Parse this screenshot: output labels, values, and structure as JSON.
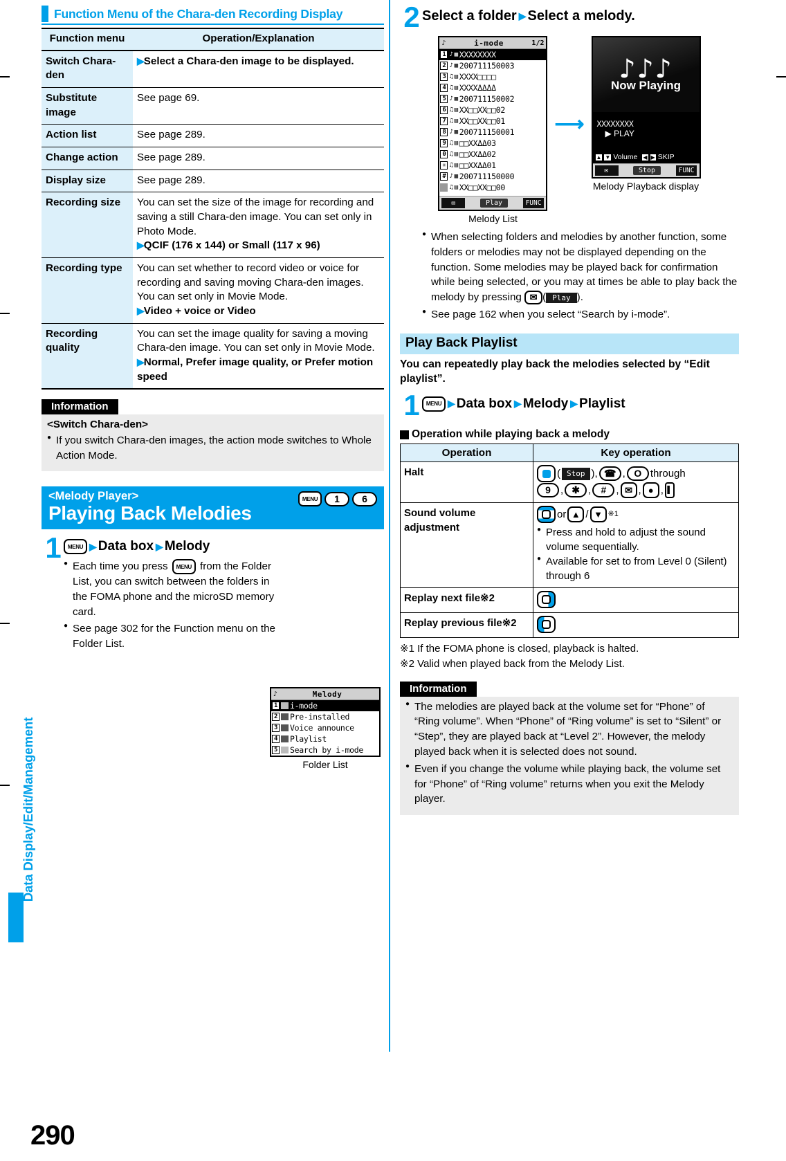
{
  "side_tab": {
    "label": "Data Display/Edit/Management"
  },
  "page_number": "290",
  "left": {
    "section_heading": "Function Menu of the Chara-den Recording Display",
    "table": {
      "headers": [
        "Function menu",
        "Operation/Explanation"
      ],
      "rows": [
        {
          "menu": "Switch Chara-den",
          "arrow": true,
          "bold_text": "Select a Chara-den image to be displayed.",
          "text": ""
        },
        {
          "menu": "Substitute image",
          "arrow": false,
          "text": "See page 69."
        },
        {
          "menu": "Action list",
          "arrow": false,
          "text": "See page 289."
        },
        {
          "menu": "Change action",
          "arrow": false,
          "text": "See page 289."
        },
        {
          "menu": "Display size",
          "arrow": false,
          "text": "See page 289."
        },
        {
          "menu": "Recording size",
          "arrow": true,
          "text": "You can set the size of the image for recording and saving a still Chara-den image. You can set only in Photo Mode.",
          "bold_text": "QCIF (176 x 144) or Small (117 x 96)"
        },
        {
          "menu": "Recording type",
          "arrow": true,
          "text": "You can set whether to record video or voice for recording and saving moving Chara-den images. You can set only in Movie Mode.",
          "bold_text": "Video + voice or Video"
        },
        {
          "menu": "Recording quality",
          "arrow": true,
          "text": "You can set the image quality for saving a moving Chara-den image. You can set only in Movie Mode.",
          "bold_text": "Normal, Prefer image quality, or Prefer motion speed"
        }
      ]
    },
    "information": {
      "tag": "Information",
      "subtitle": "<Switch Chara-den>",
      "bullets": [
        "If you switch Chara-den images, the action mode switches to Whole Action Mode."
      ]
    },
    "title_band": {
      "small": "<Melody Player>",
      "big": "Playing Back Melodies",
      "keys": [
        "MENU",
        "1",
        "6"
      ]
    },
    "step1": {
      "number": "1",
      "key": "MENU",
      "path": [
        "Data box",
        "Melody"
      ],
      "bullets": [
        "Each time you press MENU from the Folder List, you can switch between the folders in the FOMA phone and the microSD memory card.",
        "See page 302 for the Function menu on the Folder List."
      ]
    },
    "folder_list_screen": {
      "title": "Melody",
      "caption": "Folder List",
      "items": [
        {
          "idx": "1",
          "label": "i-mode",
          "selected": true
        },
        {
          "idx": "2",
          "label": "Pre-installed",
          "selected": false
        },
        {
          "idx": "3",
          "label": "Voice announce",
          "selected": false
        },
        {
          "idx": "4",
          "label": "Playlist",
          "selected": false
        },
        {
          "idx": "5",
          "label": "Search by i-mode",
          "selected": false
        }
      ]
    }
  },
  "right": {
    "step2": {
      "number": "2",
      "text_parts": [
        "Select a folder",
        "Select a melody."
      ]
    },
    "melody_list_screen": {
      "title": "i-mode",
      "page_indicator": "1/2",
      "caption": "Melody List",
      "items": [
        {
          "idx": "1",
          "label": "XXXXXXXX",
          "selected": true
        },
        {
          "idx": "2",
          "label": "200711150003",
          "selected": false
        },
        {
          "idx": "3",
          "label": "XXXX□□□□",
          "selected": false
        },
        {
          "idx": "4",
          "label": "XXXXΔΔΔΔ",
          "selected": false
        },
        {
          "idx": "5",
          "label": "200711150002",
          "selected": false
        },
        {
          "idx": "6",
          "label": "XX□□XX□□02",
          "selected": false
        },
        {
          "idx": "7",
          "label": "XX□□XX□□01",
          "selected": false
        },
        {
          "idx": "8",
          "label": "200711150001",
          "selected": false
        },
        {
          "idx": "9",
          "label": "□□XXΔΔ03",
          "selected": false
        },
        {
          "idx": "0",
          "label": "□□XXΔΔ02",
          "selected": false
        },
        {
          "idx": "✳",
          "label": "□□XXΔΔ01",
          "selected": false
        },
        {
          "idx": "#",
          "label": "200711150000",
          "selected": false
        },
        {
          "idx": "",
          "label": "XX□□XX□□00",
          "selected": false
        }
      ],
      "soft_keys": {
        "left": "mail-icon",
        "center": "Play",
        "right": "FUNC"
      }
    },
    "playback_screen": {
      "notes": "♪♪♪",
      "now_playing": "Now Playing",
      "file_name": "XXXXXXXX",
      "status": "PLAY",
      "volume_label": "Volume",
      "skip_label": "SKIP",
      "soft_keys": {
        "left": "mail-icon",
        "center": "Stop",
        "right": "FUNC"
      },
      "caption": "Melody Playback display"
    },
    "bullets_after_step2": [
      "When selecting folders and melodies by another function, some folders or melodies may not be displayed depending on the function. Some melodies may be played back for confirmation while being selected, or you may at times be able to play back the melody by pressing",
      "See page 162 when you select “Search by i-mode”."
    ],
    "play_button_label": "Play",
    "playback_playlist": {
      "band": "Play Back Playlist",
      "lead": "You can repeatedly play back the melodies selected by “Edit playlist”.",
      "step": {
        "number": "1",
        "key": "MENU",
        "path": [
          "Data box",
          "Melody",
          "Playlist"
        ]
      }
    },
    "operation_section": {
      "heading": "Operation while playing back a melody",
      "table": {
        "headers": [
          "Operation",
          "Key operation"
        ],
        "rows": [
          {
            "operation": "Halt",
            "keys_line1": [
              "center-key",
              "(",
              "Stop",
              "),",
              "call-key",
              ",",
              "0",
              "through"
            ],
            "keys_line2": [
              "9",
              ",",
              "*",
              ",",
              "#",
              ",",
              "mail-key",
              ",",
              "camera-key",
              ",",
              "side-key"
            ],
            "notes": []
          },
          {
            "operation": "Sound volume adjustment",
            "keys_line1": [
              "updown-key",
              "or",
              "up-arrow",
              "/",
              "down-arrow",
              "※1"
            ],
            "notes": [
              "Press and hold to adjust the sound volume sequentially.",
              "Available for set to from Level 0 (Silent) through 6"
            ]
          },
          {
            "operation": "Replay next file※2",
            "keys_line1": [
              "right-key"
            ],
            "notes": []
          },
          {
            "operation": "Replay previous file※2",
            "keys_line1": [
              "left-key"
            ],
            "notes": []
          }
        ]
      },
      "footnotes": [
        "※1 If the FOMA phone is closed, playback is halted.",
        "※2 Valid when played back from the Melody List."
      ]
    },
    "information": {
      "tag": "Information",
      "bullets": [
        "The melodies are played back at the volume set for “Phone” of “Ring volume”. When “Phone” of “Ring volume” is set to “Silent” or “Step”, they are played back at “Level 2”. However, the melody played back when it is selected does not sound.",
        "Even if you change the volume while playing back, the volume set for “Phone” of “Ring volume” returns when you exit the Melody player."
      ]
    }
  },
  "colors": {
    "accent": "#00a0e9",
    "table_header": "#dcf0fa",
    "info_bg": "#ebebeb",
    "band": "#b8e5f8"
  }
}
